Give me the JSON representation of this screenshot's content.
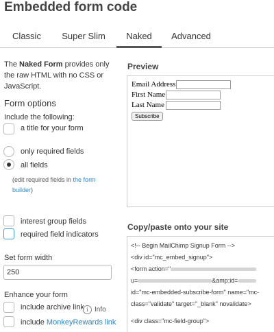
{
  "page": {
    "title": "Embedded form code"
  },
  "tabs": [
    {
      "label": "Classic"
    },
    {
      "label": "Super Slim"
    },
    {
      "label": "Naked"
    },
    {
      "label": "Advanced"
    }
  ],
  "intro": {
    "prefix": "The ",
    "bold": "Naked Form",
    "suffix": " provides only the raw HTML with no CSS or JavaScript."
  },
  "form_options": {
    "heading": "Form options",
    "include_label": "Include the following:",
    "title_checkbox": "a title for your form",
    "radio_required_only": "only required fields",
    "radio_all": "all fields",
    "note_prefix": "(edit required fields in ",
    "note_link": "the form builder",
    "note_suffix": ")",
    "interest_groups": "interest group fields",
    "required_indicators": "required field indicators"
  },
  "width": {
    "heading": "Set form width",
    "value": "250"
  },
  "enhance": {
    "heading": "Enhance your form",
    "archive_link": "include archive link",
    "info_icon": "i",
    "info_label": "Info",
    "monkey_prefix": "include ",
    "monkey_link": "MonkeyRewards link"
  },
  "preview": {
    "heading": "Preview",
    "email_label": "Email Address",
    "first_label": "First Name",
    "last_label": "Last Name",
    "subscribe": "Subscribe"
  },
  "copy": {
    "heading": "Copy/paste onto your site",
    "line1": "<!-- Begin MailChimp Signup Form -->",
    "line2": "<div id=\"mc_embed_signup\">",
    "line3": "<form action=\"",
    "line4_prefix": "u=",
    "line4_suffix": "&amp;id=",
    "line5": "id=\"mc-embedded-subscribe-form\" name=\"mc-",
    "line6": "class=\"validate\" target=\"_blank\" novalidate>",
    "line7": "<div class=\"mc-field-group\">"
  },
  "colors": {
    "link": "#2a87c7",
    "accent_border": "#3fa0d6"
  }
}
